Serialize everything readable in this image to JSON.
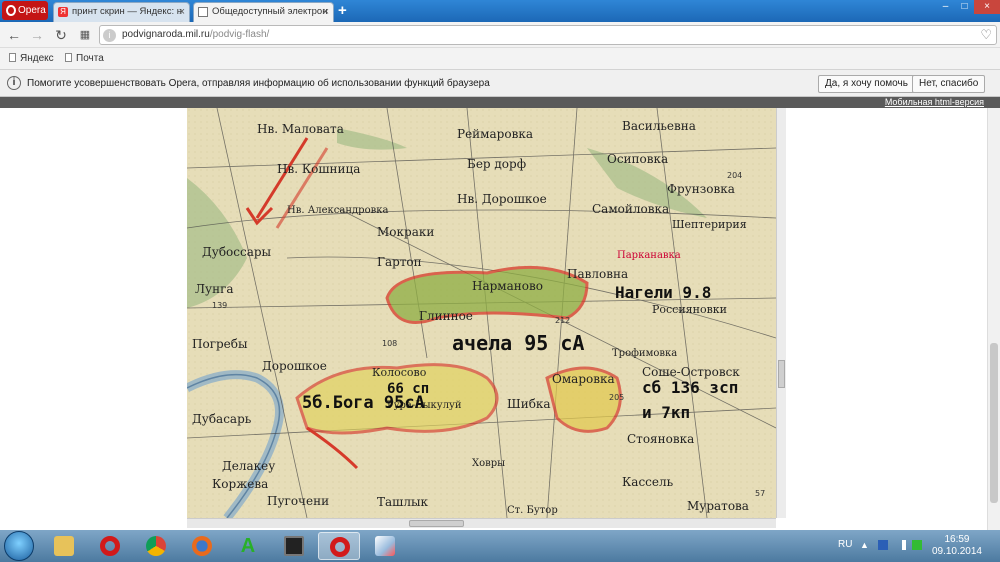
{
  "tabs": [
    {
      "title": "Opera",
      "kind": "menu"
    },
    {
      "title": "принт скрин — Яндекс: н",
      "active": false
    },
    {
      "title": "Общедоступный электрон",
      "active": true
    }
  ],
  "window_controls": [
    "–",
    "□",
    "×"
  ],
  "toolbar": {
    "back_icon": "back-arrow-icon",
    "forward_icon": "forward-arrow-icon",
    "reload_icon": "reload-icon",
    "speeddial_icon": "grid-icon",
    "url_host": "podvignaroda.mil.ru",
    "url_path": "/podvig-flash/",
    "bookmark_icon": "heart-icon"
  },
  "bookmarks": [
    "Яндекс",
    "Почта"
  ],
  "infobar": {
    "message": "Помогите усовершенствовать Opera, отправляя информацию об использовании функций браузера",
    "accept_label": "Да, я хочу помочь",
    "decline_label": "Нет, спасибо"
  },
  "page": {
    "mobile_link": "Мобильная html-версия"
  },
  "map": {
    "places": [
      "Нв. Маловата",
      "Реймаровка",
      "Васильевна",
      "Бер дорф",
      "Осиповка",
      "Нв. Кошница",
      "Нв. Александровка",
      "Нв. Дорошкое",
      "Самойловка",
      "Фрунзовка",
      "Мокраки",
      "Дубоссары",
      "Шептеририя",
      "Гартоп",
      "Парканавка",
      "Павловна",
      "Лунга",
      "Нарманово",
      "Глинное",
      "Россияновки",
      "Погребы",
      "Дорошкое",
      "Трофимовка",
      "Колосово",
      "Гура-Быкулуй",
      "Омаровка",
      "Соше-Островск",
      "Дубасарь",
      "Шибка",
      "Стояновка",
      "Делакеу",
      "Ховры",
      "Коржева",
      "Кассель",
      "Пугочени",
      "Ташлык",
      "Ст. Бутор",
      "Муратова"
    ],
    "annotations": [
      "Нагели 9.8",
      "ачела 95 сА",
      "5б.Бога 95сА",
      "сб 136 зсп",
      "и 7кп",
      "66 сп"
    ],
    "numbers": [
      "204",
      "139",
      "212",
      "108",
      "205",
      "57"
    ]
  },
  "taskbar": {
    "apps": [
      "windows-explorer",
      "opera",
      "chrome",
      "firefox",
      "green-a",
      "monitor",
      "opera-active",
      "paint"
    ],
    "language": "RU",
    "time": "16:59",
    "date": "09.10.2014"
  }
}
